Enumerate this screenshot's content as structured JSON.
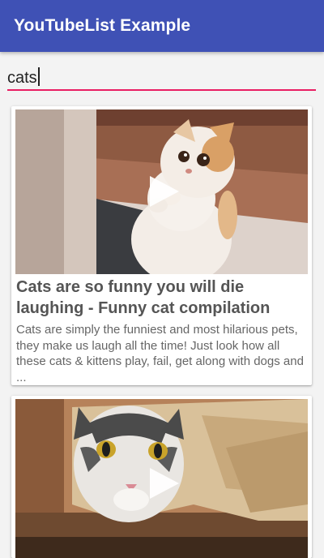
{
  "app": {
    "title": "YouTubeList Example",
    "primary_color": "#3f51b5",
    "accent_color": "#e91e63"
  },
  "search": {
    "value": "cats",
    "placeholder": ""
  },
  "videos": [
    {
      "title": "Cats are so funny you will die laughing - Funny cat compilation",
      "description": "Cats are simply the funniest and most hilarious pets, they make us laugh all the time! Just look how all these cats & kittens play, fail, get along with dogs and ...",
      "thumbnail_icon": "kitten-standing-thumbnail",
      "overlay_icon": "play-icon"
    },
    {
      "title": "",
      "description": "",
      "thumbnail_icon": "cat-in-paper-bag-thumbnail",
      "overlay_icon": "play-icon"
    }
  ]
}
